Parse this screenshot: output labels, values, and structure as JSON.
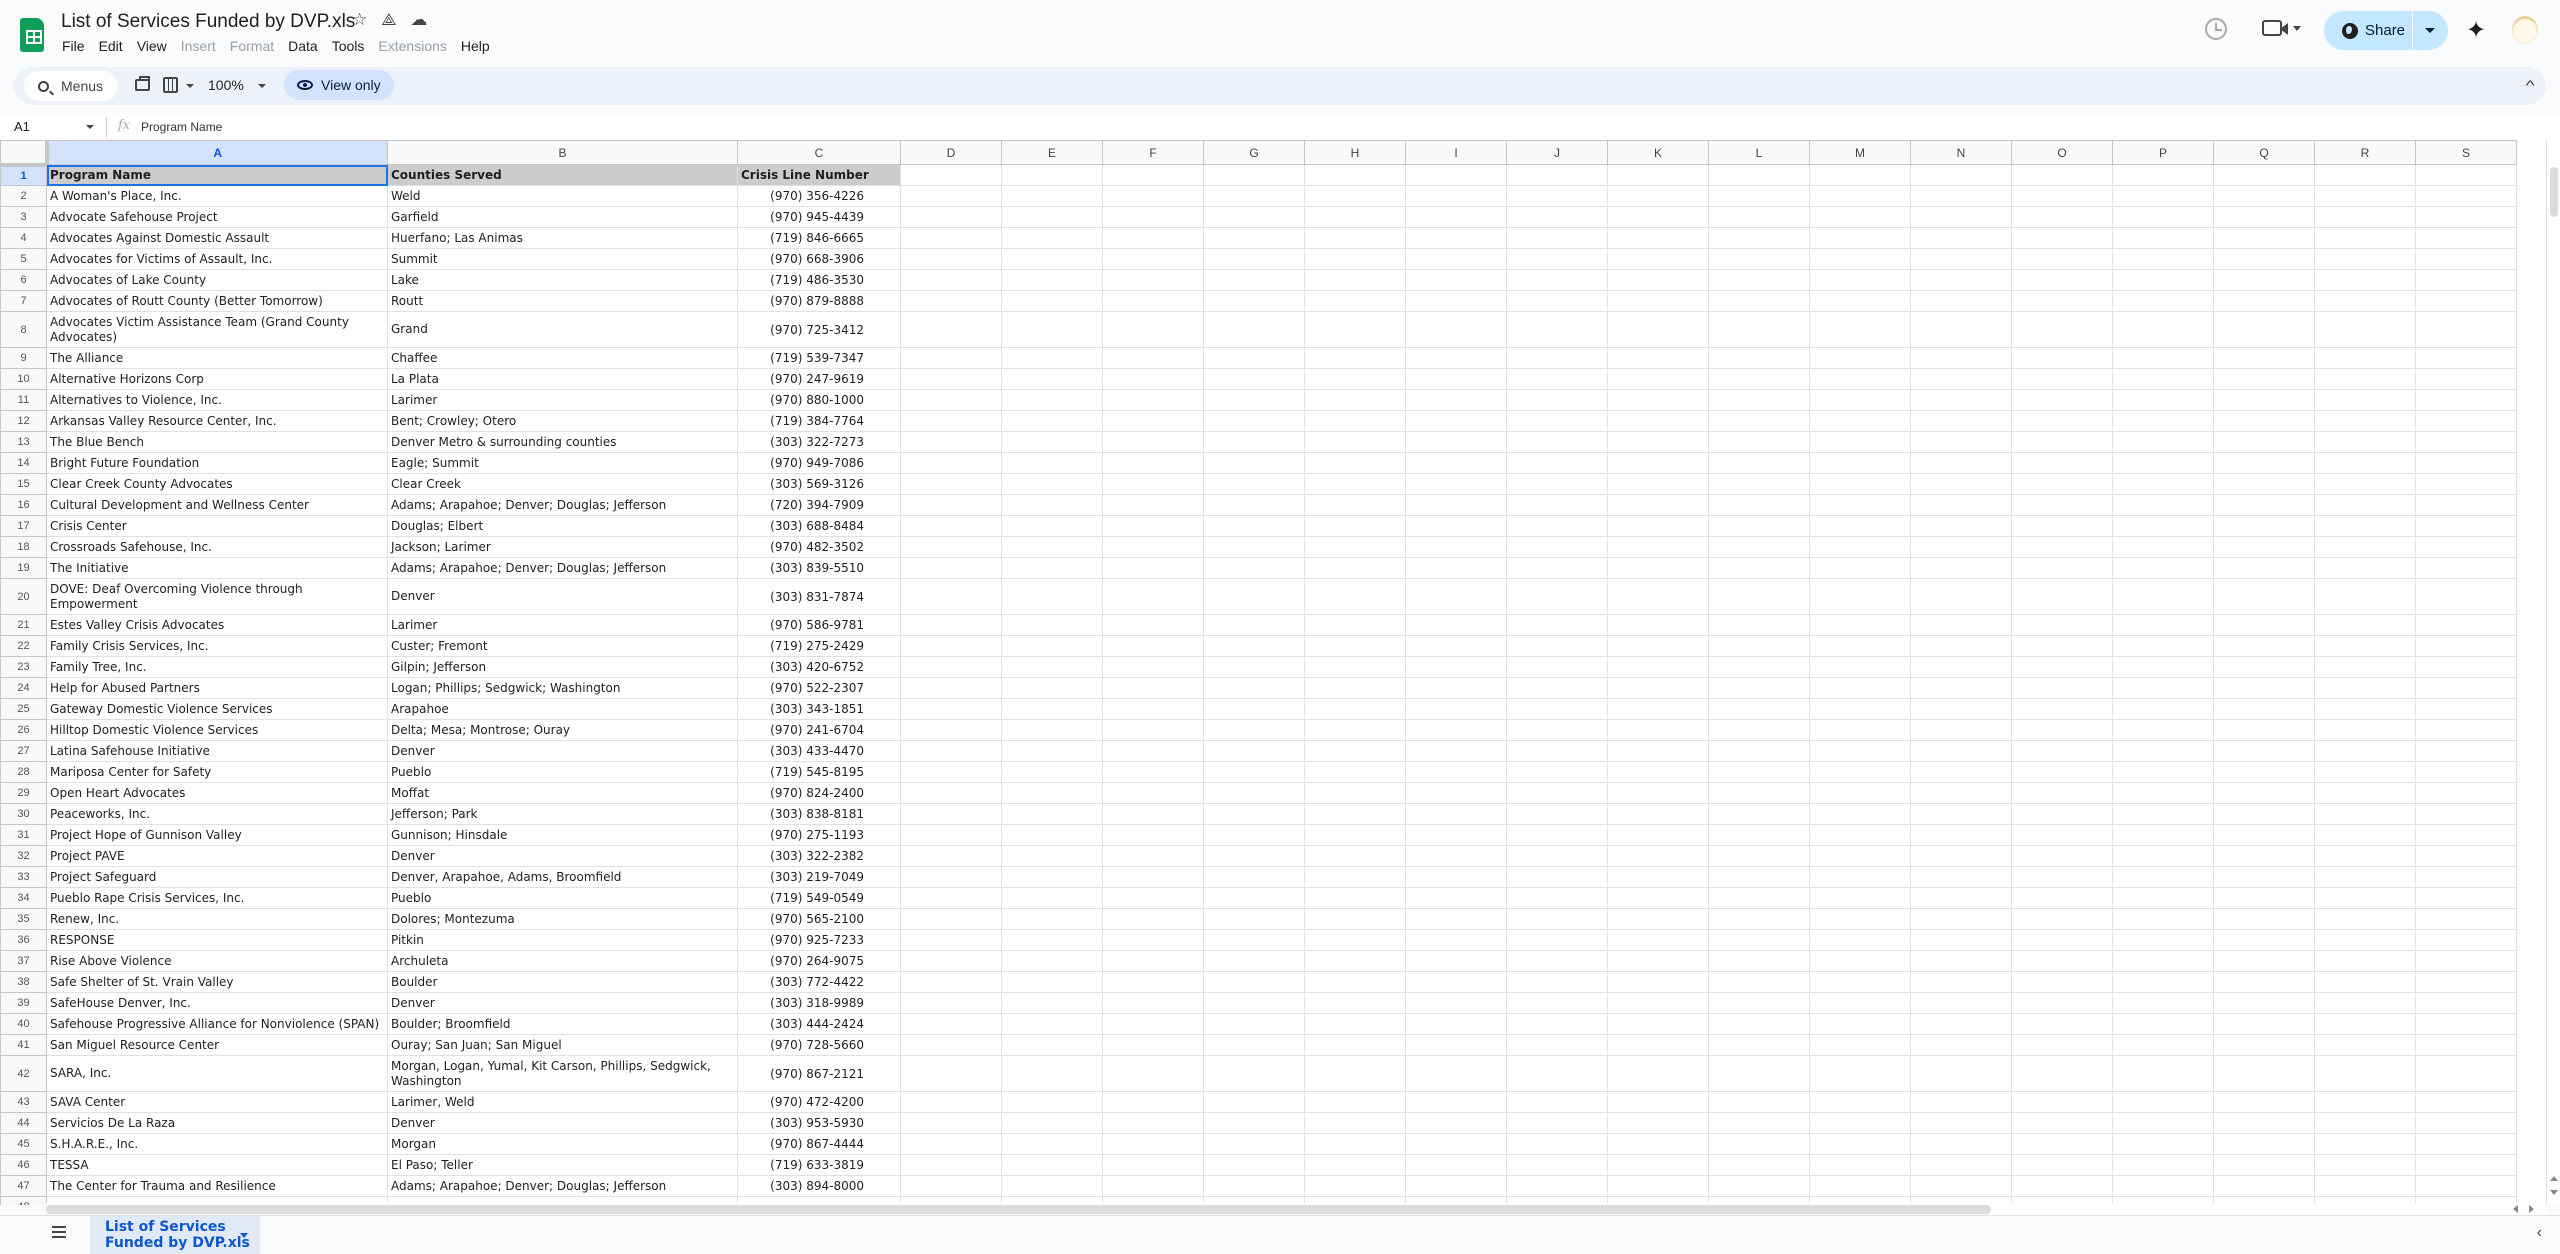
{
  "app": {
    "doc_title": "List of Services Funded by DVP.xls",
    "menu": [
      "File",
      "Edit",
      "View",
      "Insert",
      "Format",
      "Data",
      "Tools",
      "Extensions",
      "Help"
    ],
    "menu_disabled": [
      "Insert",
      "Format",
      "Extensions"
    ],
    "share_label": "Share",
    "accent_color": "#c2e7ff",
    "brand_color": "#0f9d58"
  },
  "toolbar": {
    "menus_search_label": "Menus",
    "zoom": "100%",
    "view_only_label": "View only"
  },
  "formula_bar": {
    "cell_ref": "A1",
    "fx_label": "fx",
    "content": "Program Name"
  },
  "grid": {
    "columns": [
      "A",
      "B",
      "C",
      "D",
      "E",
      "F",
      "G",
      "H",
      "I",
      "J",
      "K",
      "L",
      "M",
      "N",
      "O",
      "P",
      "Q",
      "R",
      "S"
    ],
    "selected_column": "A",
    "selected_row": 1,
    "headers": [
      "Program Name",
      "Counties Served",
      "Crisis Line Number"
    ],
    "rows": [
      {
        "n": 2,
        "program": "A Woman's Place, Inc.",
        "counties": "Weld",
        "phone": "(970) 356-4226"
      },
      {
        "n": 3,
        "program": "Advocate Safehouse Project",
        "counties": "Garfield",
        "phone": "(970) 945-4439"
      },
      {
        "n": 4,
        "program": "Advocates Against Domestic Assault",
        "counties": "Huerfano; Las Animas",
        "phone": "(719) 846-6665"
      },
      {
        "n": 5,
        "program": "Advocates for Victims of Assault, Inc.",
        "counties": "Summit",
        "phone": "(970) 668-3906"
      },
      {
        "n": 6,
        "program": "Advocates of Lake County",
        "counties": "Lake",
        "phone": "(719) 486-3530"
      },
      {
        "n": 7,
        "program": "Advocates of Routt County (Better Tomorrow)",
        "counties": "Routt",
        "phone": "(970) 879-8888"
      },
      {
        "n": 8,
        "program": "Advocates Victim Assistance Team (Grand County Advocates)",
        "counties": "Grand",
        "phone": "(970) 725-3412",
        "tall": true
      },
      {
        "n": 9,
        "program": "The Alliance",
        "counties": "Chaffee",
        "phone": "(719) 539-7347"
      },
      {
        "n": 10,
        "program": "Alternative Horizons Corp",
        "counties": "La Plata",
        "phone": "(970) 247-9619"
      },
      {
        "n": 11,
        "program": "Alternatives to Violence, Inc.",
        "counties": "Larimer",
        "phone": "(970) 880-1000"
      },
      {
        "n": 12,
        "program": "Arkansas Valley Resource Center, Inc.",
        "counties": "Bent; Crowley; Otero",
        "phone": "(719) 384-7764"
      },
      {
        "n": 13,
        "program": "The Blue Bench",
        "counties": "Denver Metro & surrounding counties",
        "phone": "(303) 322-7273"
      },
      {
        "n": 14,
        "program": "Bright Future Foundation",
        "counties": "Eagle; Summit",
        "phone": "(970) 949-7086"
      },
      {
        "n": 15,
        "program": "Clear Creek County Advocates",
        "counties": "Clear Creek",
        "phone": "(303) 569-3126"
      },
      {
        "n": 16,
        "program": "Cultural Development and Wellness Center",
        "counties": "Adams; Arapahoe; Denver; Douglas; Jefferson",
        "phone": "(720) 394-7909"
      },
      {
        "n": 17,
        "program": "Crisis Center",
        "counties": "Douglas; Elbert",
        "phone": "(303) 688-8484"
      },
      {
        "n": 18,
        "program": "Crossroads Safehouse, Inc.",
        "counties": "Jackson; Larimer",
        "phone": "(970) 482-3502"
      },
      {
        "n": 19,
        "program": "The Initiative",
        "counties": "Adams; Arapahoe; Denver; Douglas; Jefferson",
        "phone": "(303) 839-5510"
      },
      {
        "n": 20,
        "program": "DOVE: Deaf Overcoming Violence through Empowerment",
        "counties": "Denver",
        "phone": "(303) 831-7874",
        "tall": true
      },
      {
        "n": 21,
        "program": "Estes Valley Crisis Advocates",
        "counties": "Larimer",
        "phone": "(970) 586-9781"
      },
      {
        "n": 22,
        "program": "Family Crisis Services, Inc.",
        "counties": "Custer; Fremont",
        "phone": "(719) 275-2429"
      },
      {
        "n": 23,
        "program": "Family Tree, Inc.",
        "counties": "Gilpin; Jefferson",
        "phone": "(303) 420-6752"
      },
      {
        "n": 24,
        "program": "Help for Abused Partners",
        "counties": "Logan; Phillips; Sedgwick; Washington",
        "phone": "(970) 522-2307"
      },
      {
        "n": 25,
        "program": "Gateway Domestic Violence Services",
        "counties": "Arapahoe",
        "phone": "(303) 343-1851"
      },
      {
        "n": 26,
        "program": "Hilltop Domestic Violence Services",
        "counties": "Delta; Mesa; Montrose; Ouray",
        "phone": "(970) 241-6704"
      },
      {
        "n": 27,
        "program": "Latina Safehouse Initiative",
        "counties": "Denver",
        "phone": "(303) 433-4470"
      },
      {
        "n": 28,
        "program": "Mariposa Center for Safety",
        "counties": "Pueblo",
        "phone": "(719) 545-8195"
      },
      {
        "n": 29,
        "program": "Open Heart Advocates",
        "counties": "Moffat",
        "phone": "(970) 824-2400"
      },
      {
        "n": 30,
        "program": "Peaceworks, Inc.",
        "counties": "Jefferson; Park",
        "phone": "(303) 838-8181"
      },
      {
        "n": 31,
        "program": "Project Hope of Gunnison Valley",
        "counties": "Gunnison; Hinsdale",
        "phone": "(970) 275-1193"
      },
      {
        "n": 32,
        "program": "Project PAVE",
        "counties": "Denver",
        "phone": "(303) 322-2382"
      },
      {
        "n": 33,
        "program": "Project Safeguard",
        "counties": "Denver, Arapahoe, Adams, Broomfield",
        "phone": "(303) 219-7049"
      },
      {
        "n": 34,
        "program": "Pueblo Rape Crisis Services, Inc.",
        "counties": "Pueblo",
        "phone": "(719) 549-0549"
      },
      {
        "n": 35,
        "program": "Renew, Inc.",
        "counties": "Dolores; Montezuma",
        "phone": "(970) 565-2100"
      },
      {
        "n": 36,
        "program": "RESPONSE",
        "counties": "Pitkin",
        "phone": "(970) 925-7233"
      },
      {
        "n": 37,
        "program": "Rise Above Violence",
        "counties": "Archuleta",
        "phone": "(970) 264-9075"
      },
      {
        "n": 38,
        "program": "Safe Shelter of St. Vrain Valley",
        "counties": "Boulder",
        "phone": "(303) 772-4422"
      },
      {
        "n": 39,
        "program": "SafeHouse Denver, Inc.",
        "counties": "Denver",
        "phone": "(303) 318-9989"
      },
      {
        "n": 40,
        "program": "Safehouse Progressive Alliance for Nonviolence (SPAN)",
        "counties": "Boulder; Broomfield",
        "phone": "(303) 444-2424"
      },
      {
        "n": 41,
        "program": "San Miguel Resource Center",
        "counties": "Ouray; San Juan; San Miguel",
        "phone": "(970) 728-5660"
      },
      {
        "n": 42,
        "program": "SARA, Inc.",
        "counties": "Morgan, Logan, Yumal, Kit Carson, Phillips, Sedgwick, Washington",
        "phone": "(970) 867-2121",
        "tall": true
      },
      {
        "n": 43,
        "program": "SAVA Center",
        "counties": "Larimer, Weld",
        "phone": "(970) 472-4200"
      },
      {
        "n": 44,
        "program": "Servicios De La Raza",
        "counties": "Denver",
        "phone": "(303) 953-5930"
      },
      {
        "n": 45,
        "program": "S.H.A.R.E., Inc.",
        "counties": "Morgan",
        "phone": "(970) 867-4444"
      },
      {
        "n": 46,
        "program": "TESSA",
        "counties": "El Paso; Teller",
        "phone": "(719) 633-3819"
      },
      {
        "n": 47,
        "program": "The Center for Trauma and Resilience",
        "counties": "Adams; Arapahoe; Denver; Douglas; Jefferson",
        "phone": "(303) 894-8000"
      }
    ]
  },
  "sheets": {
    "active_tab": "List of Services Funded by DVP.xls"
  }
}
